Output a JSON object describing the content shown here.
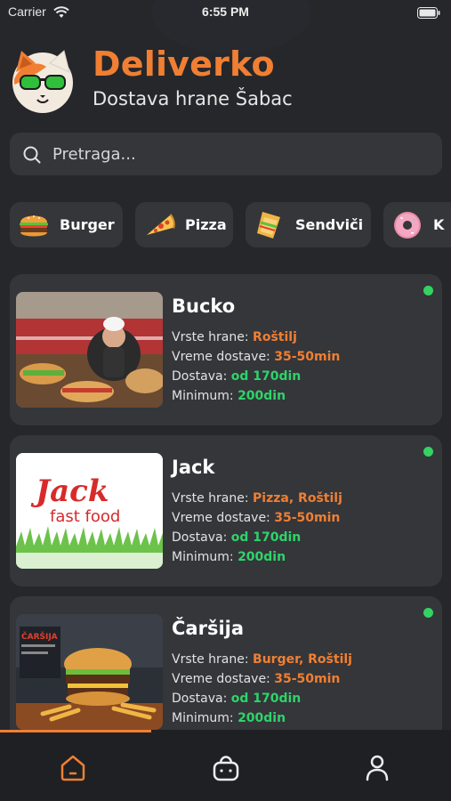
{
  "status_bar": {
    "carrier": "Carrier",
    "time": "6:55 PM"
  },
  "header": {
    "title": "Deliverko",
    "subtitle": "Dostava hrane Šabac"
  },
  "search": {
    "placeholder": "Pretraga..."
  },
  "categories": [
    {
      "label": "Burger",
      "icon": "burger-icon"
    },
    {
      "label": "Pizza",
      "icon": "pizza-icon"
    },
    {
      "label": "Sendviči",
      "icon": "sandwich-icon"
    },
    {
      "label": "K",
      "icon": "donut-icon"
    }
  ],
  "restaurants": [
    {
      "name": "Bucko",
      "food_label": "Vrste hrane:",
      "food": "Roštilj",
      "time_label": "Vreme dostave:",
      "time": "35-50min",
      "delivery_label": "Dostava:",
      "delivery": "od 170din",
      "min_label": "Minimum:",
      "min": "200din",
      "online": true
    },
    {
      "name": "Jack",
      "food_label": "Vrste hrane:",
      "food": "Pizza, Roštilj",
      "time_label": "Vreme dostave:",
      "time": "35-50min",
      "delivery_label": "Dostava:",
      "delivery": "od 170din",
      "min_label": "Minimum:",
      "min": "200din",
      "online": true,
      "logo_text_1": "Jack",
      "logo_text_2": "fast food"
    },
    {
      "name": "Čaršija",
      "food_label": "Vrste hrane:",
      "food": "Burger, Roštilj",
      "time_label": "Vreme dostave:",
      "time": "35-50min",
      "delivery_label": "Dostava:",
      "delivery": "od 170din",
      "min_label": "Minimum:",
      "min": "200din",
      "online": true,
      "sign_text": "ČARŠIJA"
    }
  ],
  "tabbar": {
    "active": "home",
    "tabs": [
      "home-icon",
      "basket-icon",
      "profile-icon"
    ]
  },
  "colors": {
    "accent": "#f07f33",
    "green": "#2fd36a",
    "background": "#25272b",
    "card": "#34363a"
  }
}
